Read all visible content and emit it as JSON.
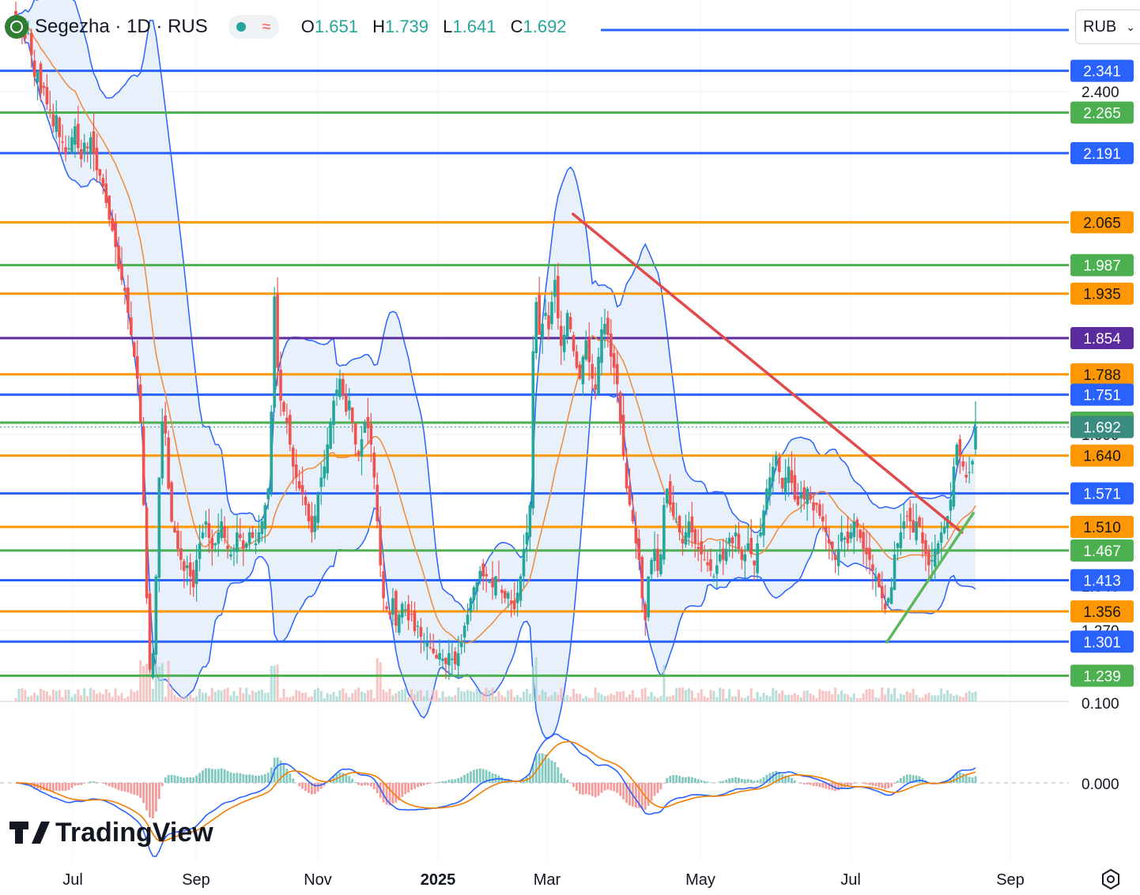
{
  "header": {
    "symbol": "Segezha · 1D · RUS",
    "o_label": "O",
    "o_value": "1.651",
    "h_label": "H",
    "h_value": "1.739",
    "l_label": "L",
    "l_value": "1.641",
    "c_label": "C",
    "c_value": "1.692",
    "icons": [
      "segezha-logo-icon",
      "live-dot-icon",
      "indicator-wave-icon"
    ]
  },
  "currency_button": {
    "label": "RUB",
    "icon": "chevron-down-icon"
  },
  "watermark": "TradingView",
  "colors": {
    "up": "#26a69a",
    "down": "#ef5350",
    "blue_level": "#2962ff",
    "green_level": "#4caf50",
    "orange_level": "#ff9800",
    "purple_level": "#5b2c9e",
    "bb_fill": "#e8f1fb",
    "trend_red": "#e04a4a",
    "trend_green": "#5cb85c",
    "macd": "#2962ff",
    "signal": "#f57c00"
  },
  "chart_data": {
    "type": "candlestick",
    "title": "Segezha · 1D · RUS",
    "currency": "RUB",
    "y_range": [
      1.192,
      2.47
    ],
    "x_labels": [
      "Jul",
      "Sep",
      "Nov",
      "2025",
      "Mar",
      "May",
      "Jul",
      "Sep"
    ],
    "price_ticks": [
      "2.400",
      "1.600",
      "1.340",
      "1.270",
      "1.210",
      "0.100"
    ],
    "macd_ticks": [
      "0.000"
    ],
    "last_price": 1.692,
    "levels": [
      {
        "value": 2.341,
        "label": "2.341",
        "color": "blue"
      },
      {
        "value": 2.265,
        "label": "2.265",
        "color": "green"
      },
      {
        "value": 2.191,
        "label": "2.191",
        "color": "blue"
      },
      {
        "value": 2.065,
        "label": "2.065",
        "color": "orange"
      },
      {
        "value": 1.987,
        "label": "1.987",
        "color": "green"
      },
      {
        "value": 1.935,
        "label": "1.935",
        "color": "orange"
      },
      {
        "value": 1.854,
        "label": "1.854",
        "color": "purple"
      },
      {
        "value": 1.788,
        "label": "1.788",
        "color": "orange"
      },
      {
        "value": 1.751,
        "label": "1.751",
        "color": "blue"
      },
      {
        "value": 1.7,
        "label": "1.700",
        "color": "green"
      },
      {
        "value": 1.692,
        "label": "1.692",
        "color": "teal"
      },
      {
        "value": 1.64,
        "label": "1.640",
        "color": "orange"
      },
      {
        "value": 1.571,
        "label": "1.571",
        "color": "blue"
      },
      {
        "value": 1.51,
        "label": "1.510",
        "color": "orange"
      },
      {
        "value": 1.467,
        "label": "1.467",
        "color": "green"
      },
      {
        "value": 1.413,
        "label": "1.413",
        "color": "blue"
      },
      {
        "value": 1.356,
        "label": "1.356",
        "color": "orange"
      },
      {
        "value": 1.301,
        "label": "1.301",
        "color": "blue"
      },
      {
        "value": 1.239,
        "label": "1.239",
        "color": "green"
      }
    ],
    "trendlines": [
      {
        "name": "descending resistance",
        "from": {
          "date": "2025-02-18",
          "price": 2.08
        },
        "to": {
          "date": "2025-08-08",
          "price": 1.5
        }
      },
      {
        "name": "ascending support",
        "from": {
          "date": "2025-07-06",
          "price": 1.3
        },
        "to": {
          "date": "2025-08-13",
          "price": 1.535
        }
      }
    ],
    "closes": [
      2.44,
      2.43,
      2.42,
      2.4,
      2.41,
      2.37,
      2.33,
      2.34,
      2.3,
      2.31,
      2.28,
      2.27,
      2.24,
      2.26,
      2.22,
      2.21,
      2.19,
      2.2,
      2.22,
      2.24,
      2.2,
      2.18,
      2.21,
      2.2,
      2.22,
      2.19,
      2.16,
      2.15,
      2.13,
      2.1,
      2.07,
      2.05,
      2.02,
      1.98,
      1.96,
      1.94,
      1.9,
      1.86,
      1.82,
      1.78,
      1.7,
      1.55,
      1.38,
      1.25,
      1.28,
      1.42,
      1.6,
      1.7,
      1.68,
      1.58,
      1.52,
      1.5,
      1.47,
      1.45,
      1.43,
      1.44,
      1.42,
      1.4,
      1.45,
      1.48,
      1.5,
      1.52,
      1.49,
      1.47,
      1.48,
      1.5,
      1.52,
      1.49,
      1.47,
      1.46,
      1.47,
      1.5,
      1.49,
      1.47,
      1.48,
      1.5,
      1.49,
      1.48,
      1.5,
      1.52,
      1.55,
      1.58,
      1.72,
      1.93,
      1.8,
      1.74,
      1.72,
      1.7,
      1.66,
      1.62,
      1.6,
      1.58,
      1.57,
      1.55,
      1.52,
      1.5,
      1.53,
      1.57,
      1.6,
      1.62,
      1.66,
      1.7,
      1.74,
      1.76,
      1.78,
      1.75,
      1.72,
      1.74,
      1.7,
      1.66,
      1.64,
      1.67,
      1.7,
      1.69,
      1.66,
      1.6,
      1.52,
      1.44,
      1.38,
      1.36,
      1.35,
      1.38,
      1.33,
      1.35,
      1.37,
      1.36,
      1.34,
      1.35,
      1.32,
      1.33,
      1.31,
      1.3,
      1.3,
      1.29,
      1.28,
      1.27,
      1.28,
      1.27,
      1.26,
      1.28,
      1.27,
      1.26,
      1.28,
      1.3,
      1.33,
      1.35,
      1.38,
      1.4,
      1.41,
      1.43,
      1.42,
      1.42,
      1.41,
      1.4,
      1.42,
      1.41,
      1.39,
      1.38,
      1.39,
      1.37,
      1.36,
      1.39,
      1.42,
      1.47,
      1.5,
      1.55,
      1.83,
      1.92,
      1.86,
      1.88,
      1.9,
      1.87,
      1.92,
      1.96,
      1.89,
      1.84,
      1.86,
      1.9,
      1.87,
      1.83,
      1.8,
      1.78,
      1.82,
      1.85,
      1.81,
      1.78,
      1.76,
      1.82,
      1.87,
      1.88,
      1.86,
      1.82,
      1.8,
      1.77,
      1.7,
      1.64,
      1.58,
      1.55,
      1.52,
      1.48,
      1.45,
      1.38,
      1.34,
      1.42,
      1.45,
      1.47,
      1.43,
      1.46,
      1.55,
      1.58,
      1.55,
      1.53,
      1.52,
      1.5,
      1.48,
      1.5,
      1.52,
      1.5,
      1.48,
      1.47,
      1.46,
      1.45,
      1.44,
      1.43,
      1.42,
      1.44,
      1.46,
      1.45,
      1.47,
      1.49,
      1.48,
      1.5,
      1.47,
      1.45,
      1.46,
      1.48,
      1.46,
      1.44,
      1.48,
      1.5,
      1.54,
      1.58,
      1.6,
      1.62,
      1.64,
      1.61,
      1.58,
      1.6,
      1.62,
      1.59,
      1.56,
      1.55,
      1.57,
      1.56,
      1.58,
      1.56,
      1.54,
      1.55,
      1.53,
      1.52,
      1.5,
      1.48,
      1.47,
      1.45,
      1.47,
      1.5,
      1.49,
      1.48,
      1.5,
      1.52,
      1.51,
      1.49,
      1.47,
      1.46,
      1.45,
      1.43,
      1.42,
      1.4,
      1.38,
      1.36,
      1.38,
      1.4,
      1.46,
      1.48,
      1.5,
      1.52,
      1.53,
      1.52,
      1.5,
      1.52,
      1.51,
      1.48,
      1.46,
      1.44,
      1.45,
      1.47,
      1.48,
      1.5,
      1.51,
      1.53,
      1.56,
      1.62,
      1.66,
      1.64,
      1.62,
      1.6,
      1.61,
      1.63,
      1.692
    ],
    "volume_note": "daily volume bars along bottom of price pane",
    "macd": {
      "zero_tick": "0.000"
    }
  }
}
